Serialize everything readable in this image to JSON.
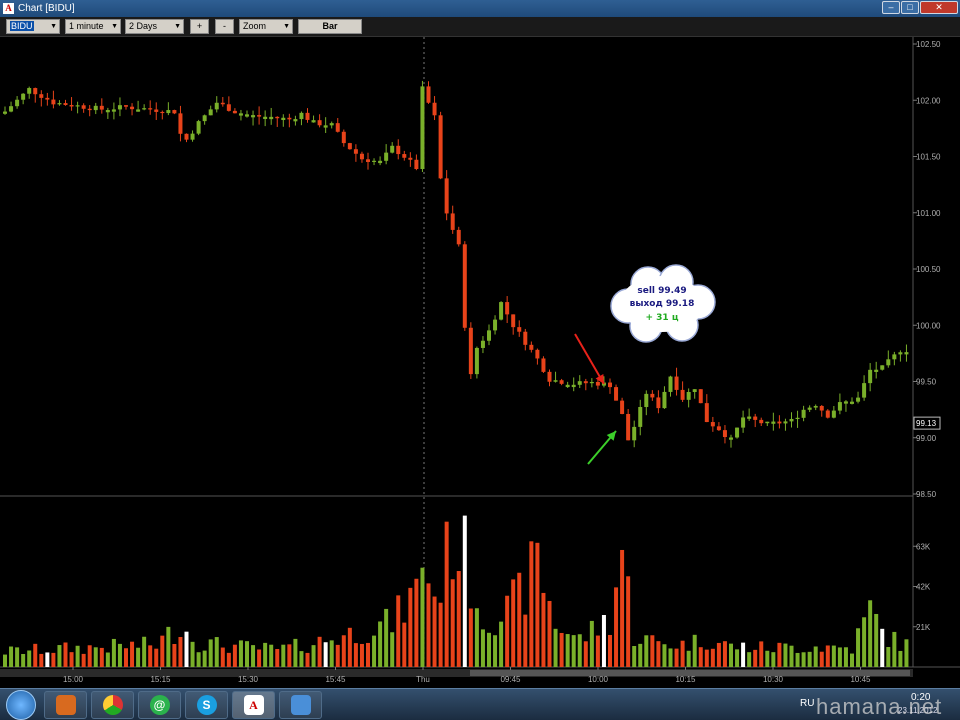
{
  "window": {
    "title": "Chart [BIDU]",
    "app_icon_letter": "A",
    "min_glyph": "–",
    "max_glyph": "□",
    "close_glyph": "✕"
  },
  "toolbar": {
    "symbol": "BIDU",
    "interval": "1 minute",
    "range": "2 Days",
    "zoom_in": "+",
    "zoom_out": "-",
    "zoom": "Zoom",
    "bar": "Bar",
    "dropdown_glyph": "▼"
  },
  "annotation": {
    "sell": "sell 99.49",
    "exit": "выход 99.18",
    "profit": "+ 31 ц"
  },
  "taskbar": {
    "lang": "RU",
    "time": "0:20",
    "date": "23.11.2012"
  },
  "watermark": "hamana.net",
  "chart_data": {
    "type": "candlestick",
    "symbol": "BIDU",
    "price_axis": {
      "labels": [
        "102.50",
        "102.00",
        "101.50",
        "101.00",
        "100.50",
        "100.00",
        "99.50",
        "99.00",
        "98.50"
      ],
      "range": [
        98.5,
        102.5
      ],
      "current_price": "99.13"
    },
    "volume_axis": {
      "labels": [
        "63K",
        "42K",
        "21K"
      ],
      "max": 84000
    },
    "time_axis": {
      "labels": [
        "15:00",
        "15:15",
        "15:30",
        "15:45",
        "Thu",
        "09:45",
        "10:00",
        "10:15",
        "10:30",
        "10:45"
      ]
    },
    "colors": {
      "up": "#7ab02a",
      "down": "#e8431a",
      "neutral": "#ffffff",
      "grid": "#2a2a2a",
      "axis_text": "#b0b0b0",
      "sell_arrow": "#e8221a",
      "exit_arrow": "#3ccf2a"
    },
    "close_path": [
      [
        0,
        101.9
      ],
      [
        4,
        102.1
      ],
      [
        8,
        101.98
      ],
      [
        12,
        101.95
      ],
      [
        16,
        101.92
      ],
      [
        20,
        101.94
      ],
      [
        24,
        101.92
      ],
      [
        28,
        101.9
      ],
      [
        29,
        101.7
      ],
      [
        30,
        101.65
      ],
      [
        32,
        101.8
      ],
      [
        35,
        101.98
      ],
      [
        38,
        101.9
      ],
      [
        41,
        101.86
      ],
      [
        44,
        101.85
      ],
      [
        47,
        101.83
      ],
      [
        49,
        101.88
      ],
      [
        51,
        101.8
      ],
      [
        54,
        101.78
      ],
      [
        56,
        101.62
      ],
      [
        59,
        101.48
      ],
      [
        62,
        101.45
      ],
      [
        64,
        101.58
      ],
      [
        66,
        101.5
      ],
      [
        68,
        101.4
      ],
      [
        69,
        102.1
      ],
      [
        71,
        101.85
      ],
      [
        72,
        101.3
      ],
      [
        73,
        101.0
      ],
      [
        75,
        100.7
      ],
      [
        76,
        100.0
      ],
      [
        77,
        99.55
      ],
      [
        78,
        99.8
      ],
      [
        80,
        99.95
      ],
      [
        82,
        100.2
      ],
      [
        84,
        100.0
      ],
      [
        86,
        99.85
      ],
      [
        88,
        99.7
      ],
      [
        90,
        99.52
      ],
      [
        94,
        99.48
      ],
      [
        97,
        99.49
      ],
      [
        100,
        99.47
      ],
      [
        102,
        99.2
      ],
      [
        103,
        98.98
      ],
      [
        104,
        99.1
      ],
      [
        106,
        99.4
      ],
      [
        108,
        99.28
      ],
      [
        110,
        99.55
      ],
      [
        112,
        99.35
      ],
      [
        114,
        99.45
      ],
      [
        116,
        99.15
      ],
      [
        118,
        99.08
      ],
      [
        120,
        98.98
      ],
      [
        122,
        99.18
      ],
      [
        126,
        99.12
      ],
      [
        130,
        99.15
      ],
      [
        132,
        99.25
      ],
      [
        134,
        99.3
      ],
      [
        136,
        99.2
      ],
      [
        138,
        99.3
      ],
      [
        141,
        99.35
      ],
      [
        143,
        99.6
      ],
      [
        145,
        99.62
      ],
      [
        148,
        99.78
      ]
    ],
    "volume_profile": [
      [
        0,
        9000
      ],
      [
        12,
        11000
      ],
      [
        25,
        13000
      ],
      [
        29,
        24000
      ],
      [
        32,
        14000
      ],
      [
        38,
        12000
      ],
      [
        45,
        10000
      ],
      [
        50,
        13000
      ],
      [
        58,
        20000
      ],
      [
        64,
        26000
      ],
      [
        68,
        44000
      ],
      [
        69,
        66000
      ],
      [
        71,
        40000
      ],
      [
        74,
        75000
      ],
      [
        76,
        64000
      ],
      [
        79,
        28000
      ],
      [
        83,
        32000
      ],
      [
        86,
        46000
      ],
      [
        88,
        62000
      ],
      [
        91,
        25000
      ],
      [
        95,
        16000
      ],
      [
        100,
        28000
      ],
      [
        102,
        68000
      ],
      [
        104,
        18000
      ],
      [
        108,
        14000
      ],
      [
        112,
        13000
      ],
      [
        116,
        16000
      ],
      [
        120,
        12000
      ],
      [
        126,
        11000
      ],
      [
        134,
        12000
      ],
      [
        140,
        11000
      ],
      [
        143,
        33000
      ],
      [
        145,
        20000
      ],
      [
        148,
        13000
      ]
    ]
  }
}
